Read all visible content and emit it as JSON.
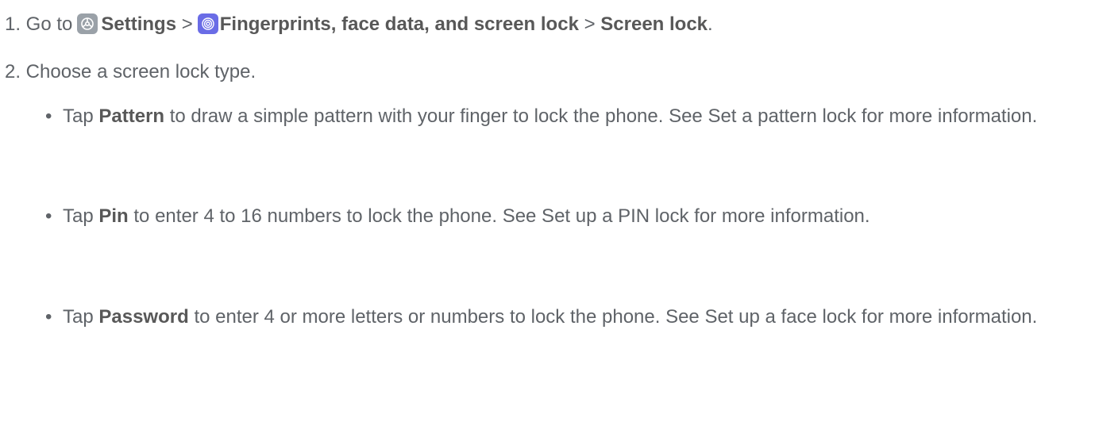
{
  "steps": {
    "step1": {
      "prefix": "1. Go to",
      "settings_label": "Settings",
      "separator1": ">",
      "fingerprints_label": "Fingerprints, face data, and screen lock",
      "separator2": ">",
      "screenlock_label": "Screen lock",
      "suffix": "."
    },
    "step2": {
      "text": "2. Choose a screen lock type."
    }
  },
  "icons": {
    "settings": "settings-gear-icon",
    "fingerprints": "fingerprint-icon",
    "settings_color": "#9aa1a8",
    "fingerprints_color": "#6a6ce6"
  },
  "bullets": [
    {
      "marker": "•",
      "tap": "Tap",
      "option": "Pattern",
      "rest": "to draw a simple pattern with your finger to lock the phone. See Set a pattern lock for more information."
    },
    {
      "marker": "•",
      "tap": "Tap",
      "option": "Pin",
      "rest": "to enter 4 to 16 numbers to lock the phone. See Set up a PIN lock for more information."
    },
    {
      "marker": "•",
      "tap": "Tap",
      "option": "Password",
      "rest": "to enter 4 or more letters or numbers to lock the phone. See Set up a face lock for more information."
    }
  ],
  "colors": {
    "text": "#5f6368",
    "bold_text": "#585858",
    "background": "#ffffff"
  }
}
